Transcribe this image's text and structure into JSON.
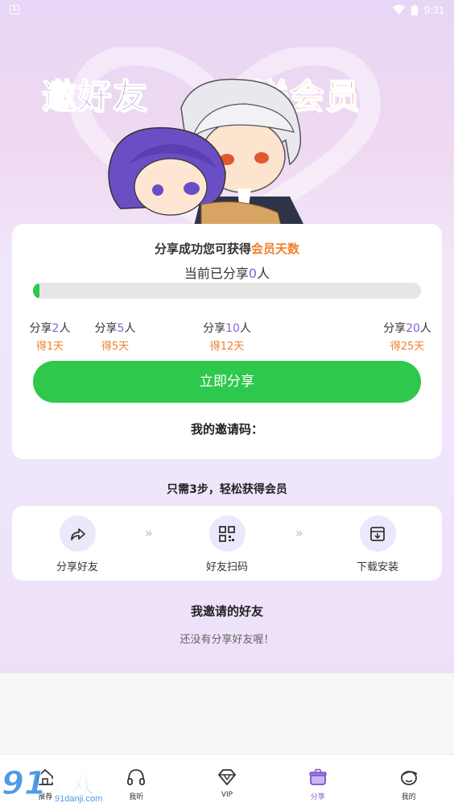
{
  "status_bar": {
    "time": "9:31",
    "app_icon_letter": "A"
  },
  "banner": {
    "title_left": "邀好友",
    "title_right": "送会员",
    "accent_left": "#5a2d8c",
    "accent_right": "#ff7d2b"
  },
  "reward": {
    "title_prefix": "分享成功您可获得",
    "title_highlight": "会员天数",
    "count_prefix": "当前已分享",
    "count_value": "0",
    "count_suffix": "人",
    "progress_fraction": 0,
    "milestones": [
      {
        "prefix": "分享",
        "num": "2",
        "suffix": "人",
        "reward": "得1天"
      },
      {
        "prefix": "分享",
        "num": "5",
        "suffix": "人",
        "reward": "得5天"
      },
      {
        "prefix": "分享",
        "num": "10",
        "suffix": "人",
        "reward": "得12天"
      },
      {
        "prefix": "分享",
        "num": "20",
        "suffix": "人",
        "reward": "得25天"
      }
    ],
    "share_button": "立即分享",
    "invite_code_label": "我的邀请码："
  },
  "steps": {
    "heading": "只需3步，轻松获得会员",
    "items": [
      {
        "label": "分享好友",
        "icon": "share-icon"
      },
      {
        "label": "好友扫码",
        "icon": "qr-code-icon"
      },
      {
        "label": "下载安装",
        "icon": "download-icon"
      }
    ],
    "arrow": "»"
  },
  "friends": {
    "title": "我邀请的好友",
    "empty": "还没有分享好友喔！"
  },
  "nav": {
    "items": [
      {
        "label": "推荐",
        "icon": "home-icon"
      },
      {
        "label": "我听",
        "icon": "headphones-icon"
      },
      {
        "label": "VIP",
        "icon": "diamond-icon"
      },
      {
        "label": "分享",
        "icon": "gift-pot-icon"
      },
      {
        "label": "我的",
        "icon": "profile-icon"
      }
    ],
    "active_index": 3
  },
  "watermark": {
    "number": "91",
    "text": "游戏",
    "url": "91danji.com"
  },
  "colors": {
    "green": "#2ec84c",
    "orange": "#f07f2a",
    "purple": "#8a5fd6"
  }
}
